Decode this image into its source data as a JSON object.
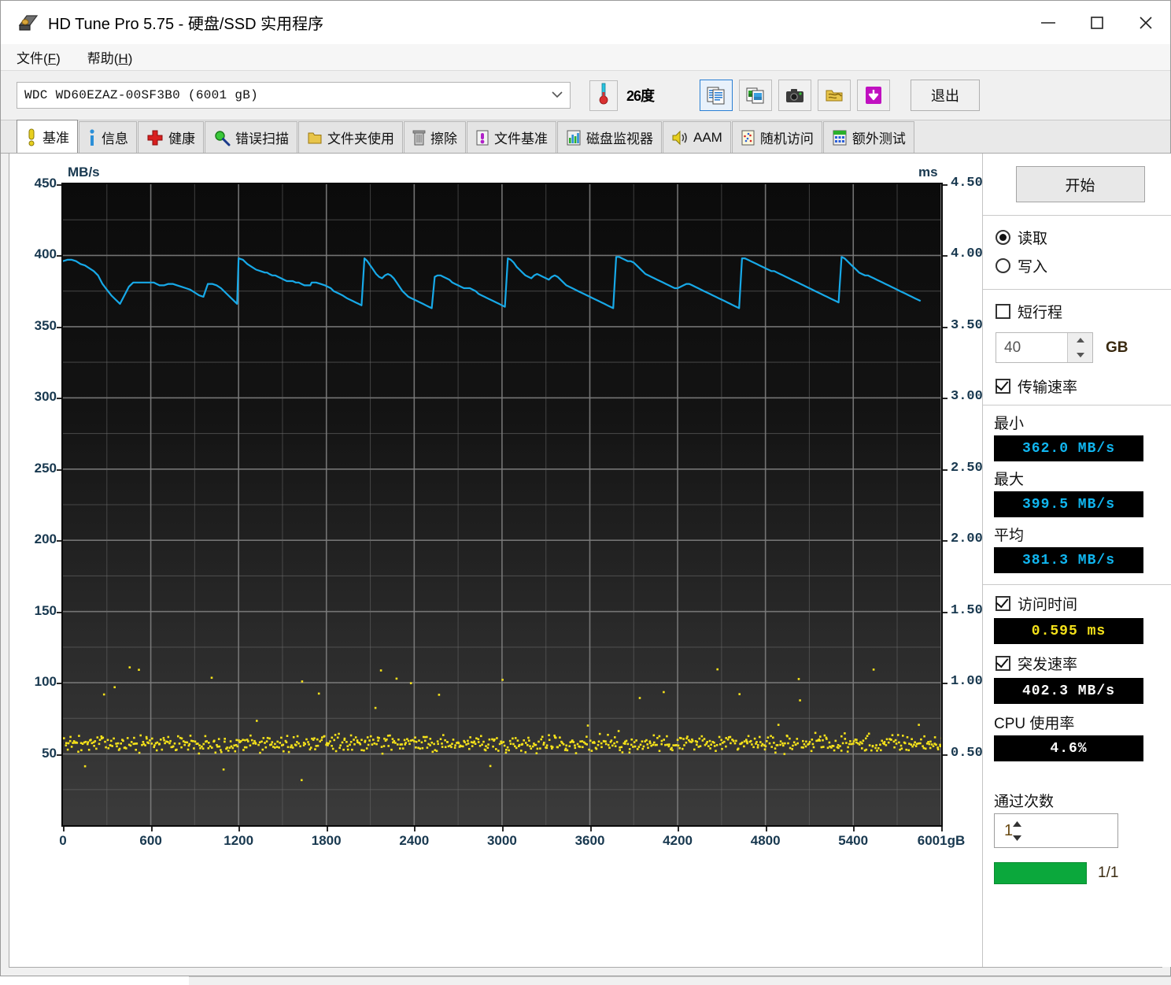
{
  "window": {
    "title": "HD Tune Pro 5.75 - 硬盘/SSD 实用程序",
    "icon": "hard-disk-icon",
    "minimize_label": "—",
    "maximize_label": "□",
    "close_label": "✕"
  },
  "menu": [
    {
      "text_before": "文件(",
      "accel": "F",
      "text_after": ")"
    },
    {
      "text_before": "帮助(",
      "accel": "H",
      "text_after": ")"
    }
  ],
  "toolbar": {
    "drive_value": "WDC WD60EZAZ-00SF3B0 (6001 gB)",
    "temperature": "26",
    "temperature_suffix": "度",
    "temperature_display": "26度",
    "exit_label": "退出",
    "buttons": [
      {
        "name": "copy-report-icon",
        "selected": true
      },
      {
        "name": "copy-image-icon",
        "selected": false
      },
      {
        "name": "screenshot-camera-icon",
        "selected": false
      },
      {
        "name": "folder-gold-icon",
        "selected": false
      },
      {
        "name": "download-arrow-icon",
        "selected": false
      }
    ]
  },
  "tabs": [
    {
      "label": "基准",
      "icon": "exclamation-yellow-icon",
      "active": true
    },
    {
      "label": "信息",
      "icon": "info-blue-icon",
      "active": false
    },
    {
      "label": "健康",
      "icon": "red-cross-icon",
      "active": false
    },
    {
      "label": "错误扫描",
      "icon": "magnifier-green-icon",
      "active": false
    },
    {
      "label": "文件夹使用",
      "icon": "folder-gold-icon",
      "active": false
    },
    {
      "label": "擦除",
      "icon": "trash-icon",
      "active": false
    },
    {
      "label": "文件基准",
      "icon": "file-benchmark-icon",
      "active": false
    },
    {
      "label": "磁盘监视器",
      "icon": "bar-monitor-icon",
      "active": false
    },
    {
      "label": "AAM",
      "icon": "speaker-icon",
      "active": false
    },
    {
      "label": "随机访问",
      "icon": "scatter-dots-icon",
      "active": false
    },
    {
      "label": "额外测试",
      "icon": "extra-tests-icon",
      "active": false
    }
  ],
  "panel": {
    "start_label": "开始",
    "read_label": "读取",
    "write_label": "写入",
    "read_selected": true,
    "write_selected": false,
    "short_stroke_label": "短行程",
    "short_stroke_checked": false,
    "short_stroke_value": "40",
    "short_stroke_unit": "GB",
    "transfer_rate_label": "传输速率",
    "transfer_rate_checked": true,
    "min_label": "最小",
    "min_value": "362.0 MB/s",
    "max_label": "最大",
    "max_value": "399.5 MB/s",
    "avg_label": "平均",
    "avg_value": "381.3 MB/s",
    "access_time_label": "访问时间",
    "access_time_checked": true,
    "access_time_value": "0.595 ms",
    "burst_rate_label": "突发速率",
    "burst_rate_checked": true,
    "burst_rate_value": "402.3 MB/s",
    "cpu_label": "CPU 使用率",
    "cpu_value": "4.6%",
    "passes_label": "通过次数",
    "passes_value": "1",
    "progress_text": "1/1",
    "progress_percent": 100,
    "progress_color": "#0ba83c"
  },
  "chart_data": {
    "type": "line",
    "title": "",
    "xlabel": "6001gB",
    "ylabel": "MB/s",
    "y2label": "ms",
    "xlim": [
      0,
      6001
    ],
    "ylim": [
      0,
      450
    ],
    "y2lim": [
      0,
      4.5
    ],
    "grid": true,
    "legend_position": "none",
    "xticks": [
      0,
      600,
      1200,
      1800,
      2400,
      3000,
      3600,
      4200,
      4800,
      5400,
      6001
    ],
    "xticklabels": [
      "0",
      "600",
      "1200",
      "1800",
      "2400",
      "3000",
      "3600",
      "4200",
      "4800",
      "5400",
      "6001gB"
    ],
    "yticks": [
      450,
      400,
      350,
      300,
      250,
      200,
      150,
      100,
      50
    ],
    "yticklabels": [
      "450",
      "400",
      "350",
      "300",
      "250",
      "200",
      "150",
      "100",
      "50"
    ],
    "y2ticks": [
      4.5,
      4.0,
      3.5,
      3.0,
      2.5,
      2.0,
      1.5,
      1.0,
      0.5
    ],
    "y2ticklabels": [
      "4.50",
      "4.00",
      "3.50",
      "3.00",
      "2.50",
      "2.00",
      "1.50",
      "1.00",
      "0.50"
    ],
    "series": [
      {
        "name": "transfer_rate",
        "type": "line",
        "color": "#17a9e8",
        "axis": "left",
        "unit": "MB/s",
        "x": [
          0,
          30,
          60,
          90,
          120,
          150,
          180,
          210,
          240,
          255,
          270,
          300,
          330,
          360,
          390,
          420,
          450,
          480,
          510,
          540,
          570,
          600,
          620,
          640,
          660,
          690,
          720,
          750,
          780,
          810,
          840,
          870,
          900,
          930,
          960,
          990,
          1020,
          1050,
          1080,
          1110,
          1140,
          1170,
          1190,
          1200,
          1230,
          1260,
          1290,
          1320,
          1350,
          1380,
          1395,
          1410,
          1430,
          1450,
          1470,
          1490,
          1510,
          1530,
          1550,
          1570,
          1590,
          1610,
          1630,
          1650,
          1670,
          1690,
          1700,
          1715,
          1730,
          1760,
          1790,
          1810,
          1830,
          1850,
          1870,
          1890,
          1910,
          1925,
          1940,
          1960,
          1980,
          2000,
          2020,
          2040,
          2060,
          2080,
          2100,
          2120,
          2140,
          2160,
          2180,
          2200,
          2220,
          2240,
          2260,
          2280,
          2300,
          2320,
          2340,
          2360,
          2380,
          2400,
          2420,
          2440,
          2460,
          2480,
          2500,
          2520,
          2540,
          2560,
          2580,
          2600,
          2620,
          2640,
          2660,
          2680,
          2700,
          2720,
          2740,
          2760,
          2780,
          2800,
          2820,
          2840,
          2860,
          2880,
          2900,
          2920,
          2940,
          2960,
          2980,
          3000,
          3020,
          3040,
          3060,
          3080,
          3100,
          3120,
          3140,
          3160,
          3180,
          3200,
          3220,
          3240,
          3260,
          3280,
          3300,
          3320,
          3340,
          3360,
          3380,
          3400,
          3420,
          3440,
          3460,
          3480,
          3500,
          3520,
          3540,
          3560,
          3580,
          3600,
          3620,
          3640,
          3660,
          3680,
          3700,
          3720,
          3740,
          3760,
          3780,
          3800,
          3820,
          3840,
          3860,
          3880,
          3900,
          3920,
          3940,
          3960,
          3980,
          4000,
          4020,
          4040,
          4060,
          4080,
          4100,
          4120,
          4140,
          4160,
          4180,
          4200,
          4220,
          4240,
          4260,
          4280,
          4300,
          4320,
          4340,
          4360,
          4380,
          4400,
          4420,
          4440,
          4460,
          4480,
          4500,
          4520,
          4540,
          4560,
          4580,
          4600,
          4620,
          4640,
          4660,
          4680,
          4700,
          4720,
          4740,
          4760,
          4780,
          4800,
          4820,
          4840,
          4860,
          4880,
          4900,
          4920,
          4940,
          4960,
          4980,
          5000,
          5020,
          5040,
          5060,
          5080,
          5100,
          5120,
          5140,
          5160,
          5180,
          5200,
          5220,
          5240,
          5260,
          5280,
          5300,
          5320,
          5340,
          5360,
          5380,
          5400,
          5420,
          5440,
          5460,
          5480,
          5500,
          5520,
          5540,
          5560,
          5580,
          5600,
          5620,
          5640,
          5660,
          5680,
          5700,
          5720,
          5740,
          5760,
          5780,
          5800,
          5820,
          5840,
          5860,
          5880,
          5900,
          5920,
          5940,
          5960,
          5980,
          6001
        ],
        "y": [
          396,
          397,
          397,
          396,
          394,
          393,
          391,
          389,
          386,
          383,
          380,
          376,
          372,
          369,
          366,
          372,
          378,
          381,
          381,
          381,
          381,
          381,
          381,
          380,
          379,
          379,
          380,
          380,
          379,
          378,
          377,
          376,
          374,
          372,
          371,
          380,
          380,
          379,
          377,
          374,
          371,
          368,
          366,
          398,
          397,
          394,
          392,
          390,
          389,
          388,
          388,
          387,
          386,
          386,
          385,
          384,
          383,
          382,
          382,
          382,
          381,
          381,
          380,
          379,
          379,
          379,
          381,
          381,
          381,
          380,
          379,
          378,
          377,
          375,
          374,
          373,
          372,
          371,
          370,
          369,
          368,
          367,
          366,
          365,
          398,
          396,
          393,
          390,
          387,
          385,
          384,
          386,
          387,
          386,
          384,
          381,
          378,
          375,
          373,
          371,
          370,
          369,
          368,
          367,
          366,
          365,
          364,
          363,
          385,
          386,
          386,
          385,
          384,
          383,
          381,
          380,
          379,
          378,
          377,
          377,
          377,
          376,
          375,
          373,
          372,
          371,
          370,
          369,
          368,
          367,
          366,
          365,
          364,
          398,
          397,
          395,
          392,
          390,
          388,
          386,
          385,
          384,
          386,
          387,
          386,
          385,
          384,
          383,
          385,
          386,
          385,
          383,
          381,
          379,
          378,
          377,
          376,
          375,
          374,
          373,
          372,
          371,
          370,
          369,
          368,
          367,
          366,
          365,
          364,
          363,
          399,
          399,
          398,
          397,
          396,
          396,
          395,
          393,
          391,
          389,
          387,
          386,
          385,
          384,
          383,
          382,
          381,
          380,
          379,
          378,
          377,
          377,
          378,
          379,
          380,
          380,
          379,
          378,
          377,
          376,
          375,
          374,
          373,
          372,
          371,
          370,
          369,
          368,
          367,
          366,
          365,
          364,
          363,
          398,
          398,
          397,
          396,
          395,
          394,
          393,
          392,
          391,
          390,
          389,
          389,
          388,
          387,
          386,
          385,
          384,
          383,
          382,
          381,
          380,
          379,
          378,
          377,
          376,
          375,
          374,
          373,
          372,
          371,
          370,
          369,
          368,
          367,
          399,
          398,
          396,
          394,
          392,
          390,
          388,
          387,
          386,
          386,
          385,
          384,
          383,
          382,
          381,
          380,
          379,
          378,
          377,
          376,
          375,
          374,
          373,
          372,
          371,
          370,
          369,
          368
        ]
      },
      {
        "name": "access_time",
        "type": "scatter",
        "color": "#f5e21a",
        "axis": "right",
        "unit": "ms",
        "mean": 0.58,
        "spread": 0.035,
        "outlier_range": [
          0.3,
          1.12
        ],
        "point_count": 820
      }
    ]
  }
}
